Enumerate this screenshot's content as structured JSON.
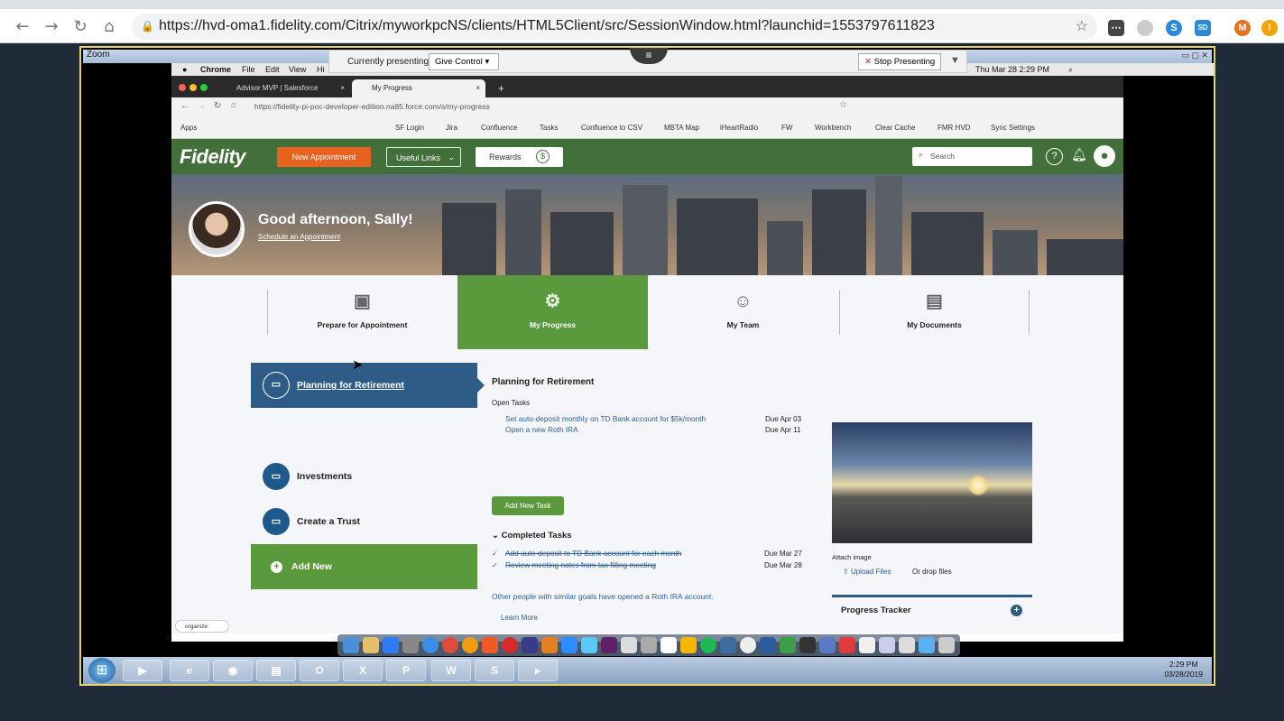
{
  "outer_browser": {
    "url": "https://hvd-oma1.fidelity.com/Citrix/myworkpcNS/clients/HTML5Client/src/SessionWindow.html?launchid=1553797611823",
    "ext_badge": "SD",
    "profile_initial": "M",
    "warn_icon": "!"
  },
  "citrix": {
    "window_title": "Zoom",
    "presenting_label": "Currently presenting",
    "give_control": "Give Control",
    "stop_presenting": "Stop Presenting"
  },
  "mac_menu": {
    "items": [
      "Chrome",
      "File",
      "Edit",
      "View",
      "Hi"
    ],
    "clock": "Thu Mar 28  2:29 PM"
  },
  "inner_browser": {
    "tabs": [
      "Advisor MVP | Salesforce",
      "My Progress"
    ],
    "new_tab": "+",
    "url": "https://fidelity-pi-poc-developer-edition.na85.force.com/s/my-progress",
    "bookmarks": [
      "Apps",
      "SF Login",
      "Jira",
      "Confluence",
      "Tasks",
      "Confluence to CSV",
      "MBTA Map",
      "iHeartRadio",
      "FW",
      "Workbench",
      "Clear Cache",
      "FMR HVD",
      "Sync Settings"
    ]
  },
  "header": {
    "logo": "Fidelity",
    "new_appointment": "New Appointment",
    "useful_links": "Useful Links",
    "rewards": "Rewards",
    "rewards_symbol": "$",
    "search_placeholder": "Search",
    "help": "?"
  },
  "banner": {
    "greeting": "Good afternoon, Sally!",
    "schedule_link": "Schedule an Appointment"
  },
  "nav_tabs": [
    {
      "label": "Prepare for Appointment"
    },
    {
      "label": "My Progress"
    },
    {
      "label": "My Team"
    },
    {
      "label": "My Documents"
    }
  ],
  "goals": {
    "items": [
      "Planning for Retirement",
      "Investments",
      "Create a Trust"
    ],
    "add_new": "Add New"
  },
  "detail": {
    "title": "Planning for Retirement",
    "open_tasks_heading": "Open Tasks",
    "open_tasks": [
      {
        "text": "Set auto-deposit monthly on TD Bank account for $5k/month",
        "due": "Due Apr 03"
      },
      {
        "text": "Open a new Roth IRA",
        "due": "Due Apr 11"
      }
    ],
    "add_task": "Add New Task",
    "completed_heading": "Completed Tasks",
    "completed_tasks": [
      {
        "text": "Add auto-deposit to TD Bank account for each month",
        "due": "Due Mar 27"
      },
      {
        "text": "Review meeting notes from tax filling meeting",
        "due": "Due Mar 28"
      }
    ],
    "others_text": "Other people with similar goals have opened a Roth IRA account.",
    "learn_more": "Learn More"
  },
  "side_panel": {
    "attach_label": "Attach image",
    "upload": "Upload Files",
    "drop": "Or drop files",
    "tracker": "Progress Tracker"
  },
  "organize": "organize",
  "taskbar": {
    "clock_time": "2:29 PM",
    "clock_date": "03/28/2019"
  }
}
